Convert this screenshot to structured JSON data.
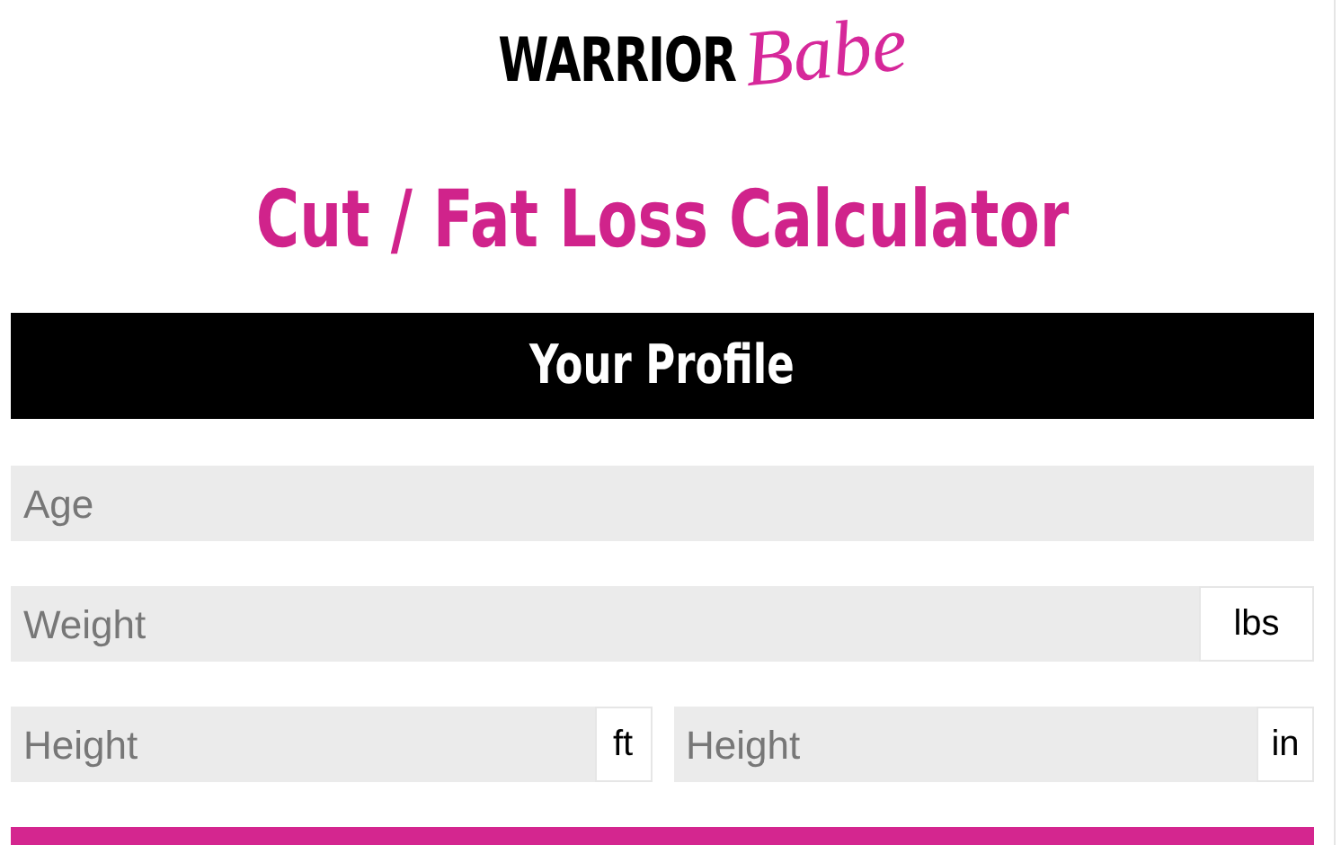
{
  "logo": {
    "word_1": "WARRIOR",
    "word_2": "Babe"
  },
  "title": "Cut / Fat Loss Calculator",
  "section_header": "Your Profile",
  "form_rows": [
    {
      "fields": [
        {
          "placeholder": "Age"
        }
      ]
    },
    {
      "fields": [
        {
          "placeholder": "Weight",
          "unit": "lbs"
        }
      ]
    },
    {
      "fields": [
        {
          "placeholder": "Height",
          "unit": "ft"
        },
        {
          "placeholder": "Height",
          "unit": "in"
        }
      ]
    }
  ]
}
